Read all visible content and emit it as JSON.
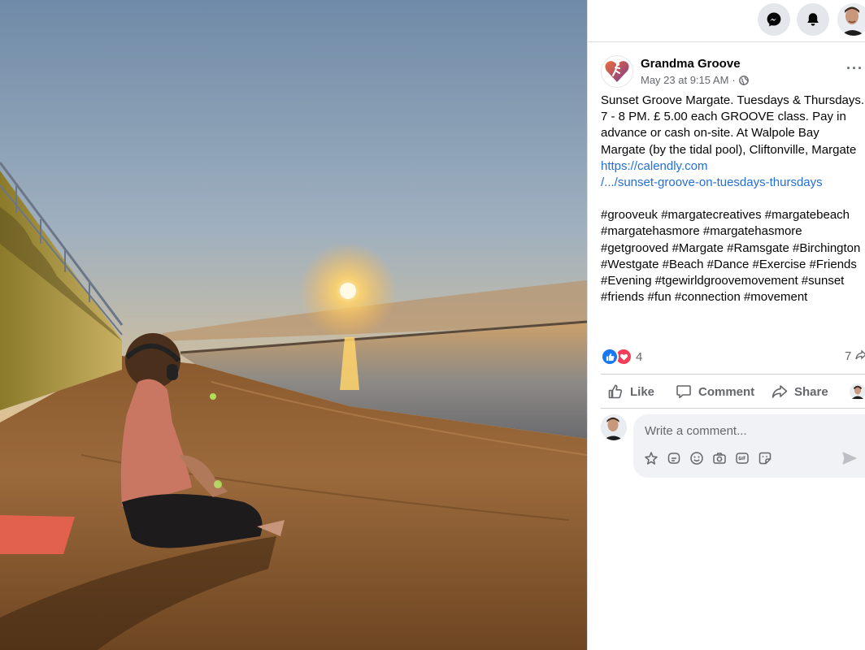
{
  "photo": {
    "description_icon": "beach-sunset-photo"
  },
  "topbar": {
    "messenger_icon": "messenger-icon",
    "notifications_icon": "bell-icon",
    "profile_icon": "profile-avatar"
  },
  "post": {
    "page_name": "Grandma Groove",
    "timestamp": "May 23 at 9:15 AM",
    "audience_icon": "globe-icon",
    "more_label": "···",
    "text": "Sunset Groove Margate. Tuesdays & Thursdays. 7 - 8 PM. £ 5.00 each GROOVE class. Pay in advance or cash on-site. At Walpole Bay Margate (by the tidal pool), Cliftonville, Margate ",
    "link_line1": "https://calendly.com",
    "link_line2": "/.../sunset-groove-on-tuesdays-thursdays",
    "hashtags": "#grooveuk #margatecreatives #margatebeach #margatehasmore #margatehasmore #getgrooved #Margate #Ramsgate #Birchington #Westgate #Beach #Dance #Exercise #Friends #Evening #tgewirldgroovemovement #sunset #friends #fun #connection #movement"
  },
  "reactions": {
    "count": "4",
    "types": [
      "like-reaction-icon",
      "love-reaction-icon"
    ],
    "shares": "7"
  },
  "actions": {
    "like": "Like",
    "comment": "Comment",
    "share": "Share"
  },
  "comment_box": {
    "placeholder": "Write a comment...",
    "tools": [
      "avatar-sticker-icon",
      "sticker-icon",
      "emoji-icon",
      "camera-icon",
      "gif-icon",
      "sticker-face-icon"
    ],
    "send_icon": "send-icon"
  },
  "colors": {
    "link": "#216fdb",
    "like_blue": "#1877f2",
    "love_red": "#f33e58",
    "secondary_text": "#65676b"
  }
}
